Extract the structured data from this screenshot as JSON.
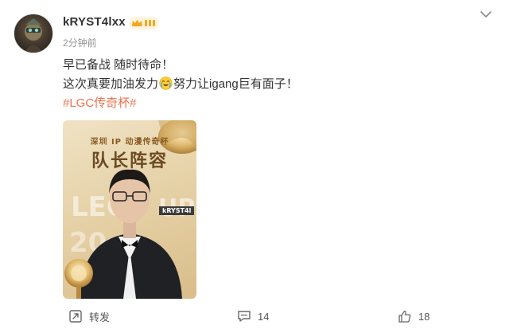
{
  "post": {
    "username": "kRYST4lxx",
    "time": "2分钟前",
    "line1": "早已备战 随时待命！",
    "line2_before_emoji": "这次真要加油发力",
    "line2_after_emoji": "努力让igang巨有面子！",
    "hashtag": "#LGC传奇杯#",
    "emoji_name": "crying-laugh-emoji"
  },
  "photo": {
    "subtitle": "深圳 IP 动漫传奇杯",
    "title": "队长阵容",
    "name_tag": "kRYST4l"
  },
  "actions": {
    "repost_label": "转发",
    "comment_count": "14",
    "like_count": "18"
  },
  "icons": {
    "more": "chevron-down-icon",
    "repost": "repost-icon",
    "comment": "comment-icon",
    "like": "thumbs-up-icon",
    "badge": "vip-crown-badge"
  },
  "colors": {
    "hashtag": "#eb7350",
    "badge_gold": "#f5a623",
    "muted_text": "#939393"
  }
}
